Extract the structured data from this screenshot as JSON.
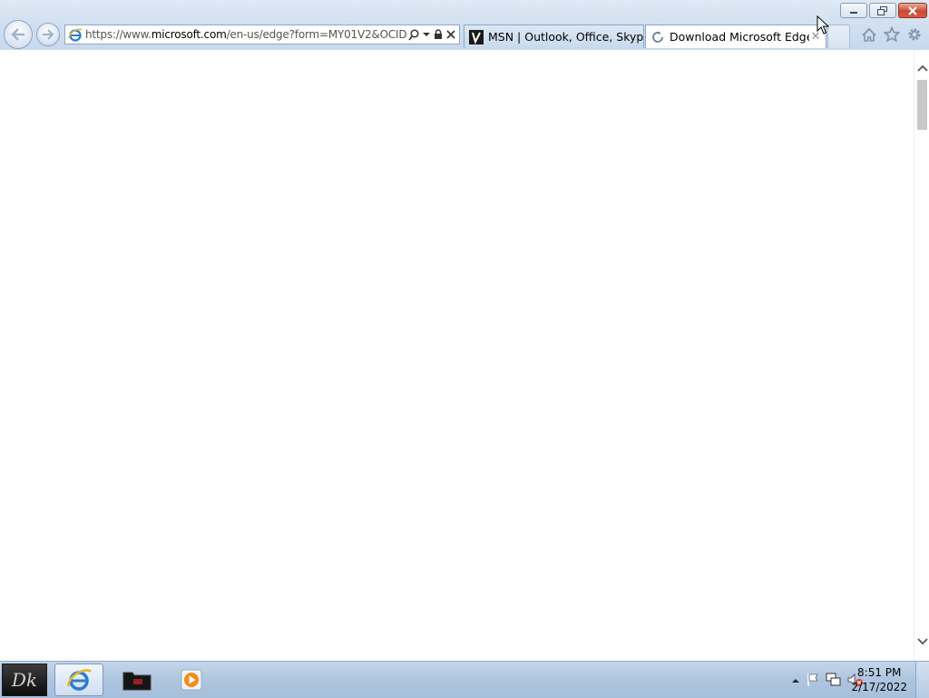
{
  "browser": {
    "address": {
      "url_prefix": "https://www.",
      "url_domain": "microsoft.com",
      "url_rest": "/en-us/edge?form=MY01V2&OCID="
    },
    "tabs": [
      {
        "title": "MSN | Outlook, Office, Skype, ...",
        "favicon": "msn-icon",
        "active": false
      },
      {
        "title": "Download Microsoft Edge ...",
        "favicon": "loading-spinner-icon",
        "active": true
      }
    ],
    "close_glyph": "✕"
  },
  "taskbar": {
    "start_label": "Dk",
    "clock_time": "8:51 PM",
    "clock_date": "2/17/2022"
  },
  "colors": {
    "chrome_blue": "#d2e0f1",
    "close_red": "#c94a32",
    "taskbar_blue": "#aec5df"
  }
}
